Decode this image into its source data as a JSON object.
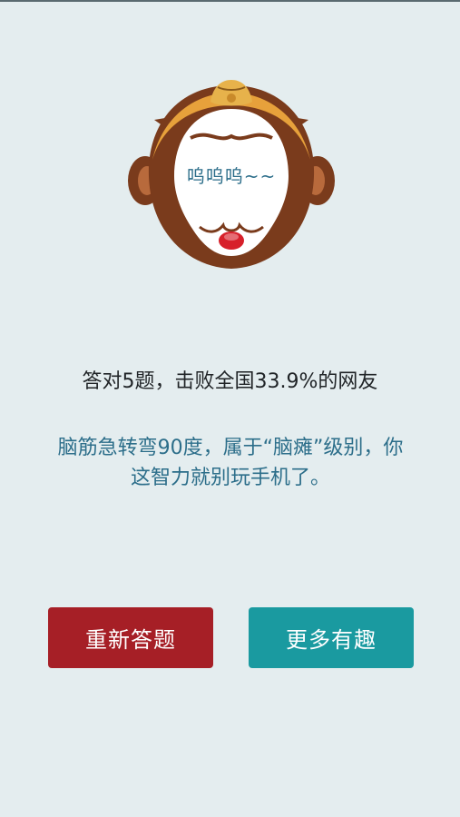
{
  "avatar": {
    "icon": "monkey-face-icon",
    "face_text": "呜呜呜~~"
  },
  "result": {
    "text": "答对5题，击败全国33.9%的网友"
  },
  "comment": {
    "line1": "脑筋急转弯90度，属于“脑瘫”级别，你",
    "line2": "这智力就别玩手机了。"
  },
  "buttons": {
    "retry_label": "重新答题",
    "more_label": "更多有趣"
  },
  "colors": {
    "background": "#e4edef",
    "retry_button": "#a61f26",
    "more_button": "#1a9aa0",
    "comment_text": "#2c6e8a"
  }
}
